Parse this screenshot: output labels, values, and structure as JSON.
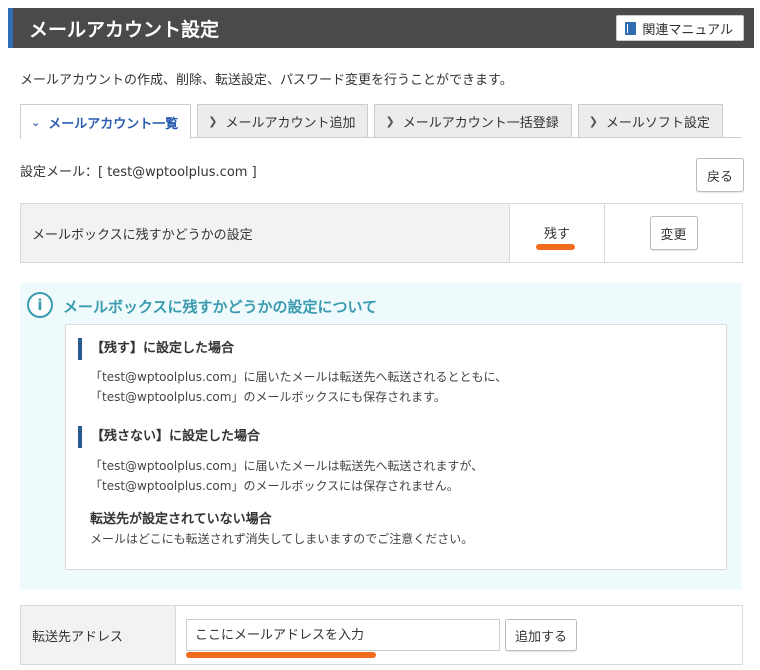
{
  "header": {
    "title": "メールアカウント設定",
    "manual_label": "関連マニュアル"
  },
  "description": "メールアカウントの作成、削除、転送設定、パスワード変更を行うことができます。",
  "tabs": [
    {
      "label": "メールアカウント一覧",
      "active": true
    },
    {
      "label": "メールアカウント追加",
      "active": false
    },
    {
      "label": "メールアカウント一括登録",
      "active": false
    },
    {
      "label": "メールソフト設定",
      "active": false
    }
  ],
  "setting_mail": "設定メール：[ test@wptoolplus.com ]",
  "back_label": "戻る",
  "mailbox_setting": {
    "label": "メールボックスに残すかどうかの設定",
    "value": "残す",
    "change_label": "変更"
  },
  "info": {
    "title": "メールボックスに残すかどうかの設定について",
    "keep": {
      "heading": "【残す】に設定した場合",
      "lines": [
        "「test@wptoolplus.com」に届いたメールは転送先へ転送されるとともに、",
        "「test@wptoolplus.com」のメールボックスにも保存されます。"
      ]
    },
    "nokeep": {
      "heading": "【残さない】に設定した場合",
      "lines": [
        "「test@wptoolplus.com」に届いたメールは転送先へ転送されますが、",
        "「test@wptoolplus.com」のメールボックスには保存されません。"
      ]
    },
    "no_forward_heading": "転送先が設定されていない場合",
    "no_forward_text": "メールはどこにも転送されず消失してしまいますのでご注意ください。"
  },
  "forward": {
    "label": "転送先アドレス",
    "placeholder": "ここにメールアドレスを入力",
    "value": "",
    "add_label": "追加する"
  },
  "colors": {
    "header_bg": "#4a4a4a",
    "accent_blue": "#2a5db0",
    "info_teal": "#3a9bb0",
    "highlight_orange": "#f26b1d"
  }
}
